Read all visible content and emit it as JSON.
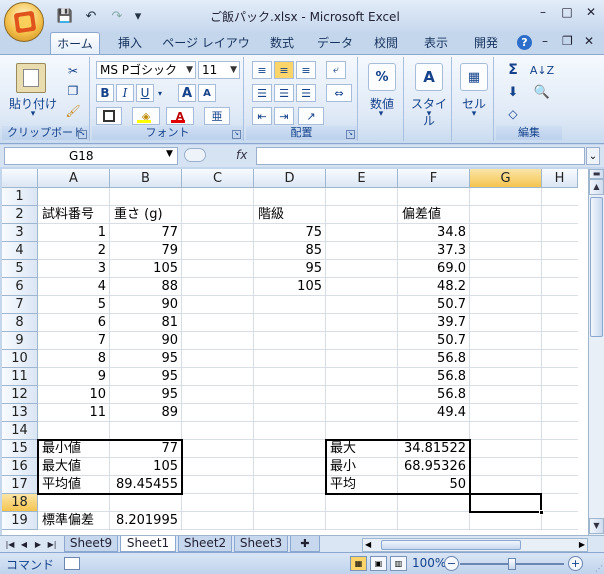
{
  "window": {
    "title": "ご飯パック.xlsx - Microsoft Excel",
    "controls": [
      "–",
      "□",
      "✕"
    ],
    "ribbon_controls": [
      "–",
      "❐",
      "✕"
    ]
  },
  "qat": {
    "save_icon": "💾",
    "undo": "↶",
    "redo": "↷",
    "customize": "▾"
  },
  "tabs": [
    {
      "label": "ホーム",
      "active": true
    },
    {
      "label": "挿入"
    },
    {
      "label": "ページ レイアウト"
    },
    {
      "label": "数式"
    },
    {
      "label": "データ"
    },
    {
      "label": "校閲"
    },
    {
      "label": "表示"
    },
    {
      "label": "開発"
    }
  ],
  "help": "?",
  "ribbon": {
    "clipboard": {
      "label": "クリップボード",
      "paste": "貼り付け"
    },
    "font": {
      "label": "フォント",
      "name": "MS Pゴシック",
      "size": "11",
      "bold": "B",
      "italic": "I",
      "underline": "U",
      "grow": "A",
      "shrink": "A",
      "phonetic": "亜"
    },
    "alignment": {
      "label": "配置"
    },
    "number": {
      "label": "数値"
    },
    "styles": {
      "label": "スタイル"
    },
    "cells": {
      "label": "セル"
    },
    "editing": {
      "label": "編集"
    }
  },
  "formula_bar": {
    "name_box": "G18",
    "fx": "fx",
    "value": ""
  },
  "grid": {
    "columns": [
      "A",
      "B",
      "C",
      "D",
      "E",
      "F",
      "G",
      "H"
    ],
    "selected_column": "G",
    "rows": [
      "1",
      "2",
      "3",
      "4",
      "5",
      "6",
      "7",
      "8",
      "9",
      "10",
      "11",
      "12",
      "13",
      "14",
      "15",
      "16",
      "17",
      "18",
      "19"
    ],
    "selected_row": "18",
    "cells": {
      "A2": "試料番号",
      "B2": "重さ (g)",
      "D2": "階級",
      "F2": "偏差値",
      "A3": "1",
      "B3": "77",
      "D3": "75",
      "F3": "34.8",
      "A4": "2",
      "B4": "79",
      "D4": "85",
      "F4": "37.3",
      "A5": "3",
      "B5": "105",
      "D5": "95",
      "F5": "69.0",
      "A6": "4",
      "B6": "88",
      "D6": "105",
      "F6": "48.2",
      "A7": "5",
      "B7": "90",
      "F7": "50.7",
      "A8": "6",
      "B8": "81",
      "F8": "39.7",
      "A9": "7",
      "B9": "90",
      "F9": "50.7",
      "A10": "8",
      "B10": "95",
      "F10": "56.8",
      "A11": "9",
      "B11": "95",
      "F11": "56.8",
      "A12": "10",
      "B12": "95",
      "F12": "56.8",
      "A13": "11",
      "B13": "89",
      "F13": "49.4",
      "A15": "最小値",
      "B15": "77",
      "E15": "最大",
      "F15": "34.81522",
      "A16": "最大値",
      "B16": "105",
      "E16": "最小",
      "F16": "68.95326",
      "A17": "平均値",
      "B17": "89.45455",
      "E17": "平均",
      "F17": "50",
      "A19": "標準偏差",
      "B19": "8.201995"
    }
  },
  "sheets": [
    {
      "label": "Sheet9"
    },
    {
      "label": "Sheet1",
      "active": true
    },
    {
      "label": "Sheet2"
    },
    {
      "label": "Sheet3"
    }
  ],
  "status": {
    "mode": "コマンド",
    "zoom": "100%",
    "zoom_level_percent": 100,
    "zoom_out": "−",
    "zoom_in": "+"
  }
}
